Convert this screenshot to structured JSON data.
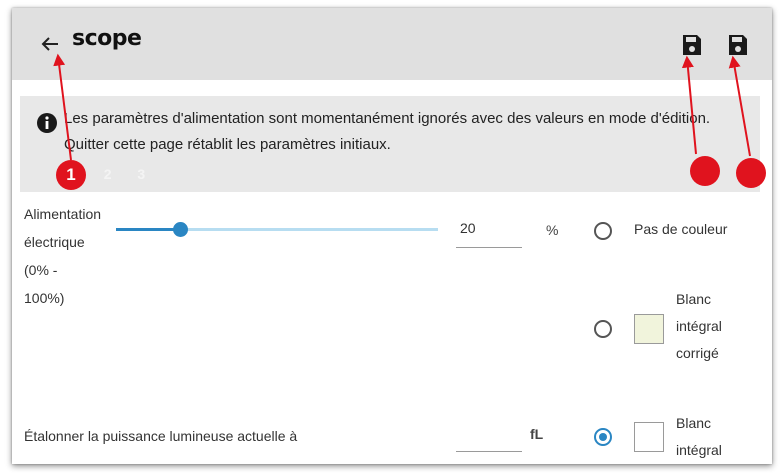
{
  "appbar": {
    "title": "scope",
    "back_icon": "arrow-left-icon",
    "save_icon": "floppy-save-icon"
  },
  "info": {
    "icon": "info-circle-icon",
    "text": "Les paramètres d'alimentation sont momentanément ignorés avec des valeurs en mode d'édition. Quitter cette page rétablit les paramètres initiaux.",
    "steps": [
      "1",
      "2",
      "3"
    ]
  },
  "annotations": {
    "marker_1": "1",
    "marker_color": "#e0131e"
  },
  "power": {
    "label_lines": [
      "Alimentation",
      "électrique",
      "(0% -",
      "100%)"
    ],
    "value": "20",
    "unit": "%",
    "slider_fraction": 0.2,
    "accent": "#2a86c3"
  },
  "color_options": [
    {
      "label_lines": [
        "Pas de couleur"
      ],
      "selected": false,
      "swatch": null
    },
    {
      "label_lines": [
        "Blanc",
        "intégral",
        "corrigé"
      ],
      "selected": false,
      "swatch": "#f1f4dc"
    },
    {
      "label_lines": [
        "Blanc",
        "intégral"
      ],
      "selected": true,
      "swatch": "#ffffff"
    }
  ],
  "calibrate": {
    "label": "Étalonner la puissance lumineuse actuelle à",
    "value": "",
    "unit": "fL"
  }
}
